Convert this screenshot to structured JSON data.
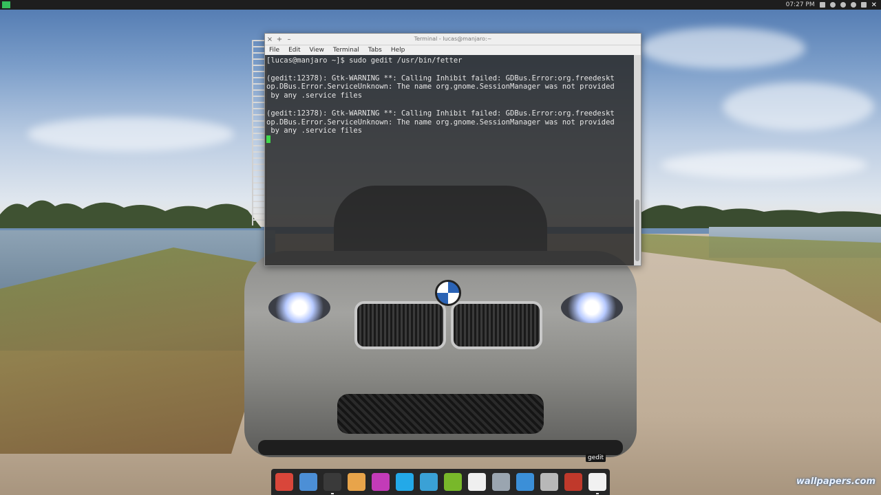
{
  "top_panel": {
    "clock": "07:27 PM"
  },
  "terminal": {
    "title": "Terminal - lucas@manjaro:~",
    "controls": {
      "close": "×",
      "maximize": "+",
      "minimize": "–"
    },
    "menu": [
      "File",
      "Edit",
      "View",
      "Terminal",
      "Tabs",
      "Help"
    ],
    "lines": [
      "[lucas@manjaro ~]$ sudo gedit /usr/bin/fetter",
      "",
      "(gedit:12378): Gtk-WARNING **: Calling Inhibit failed: GDBus.Error:org.freedeskt",
      "op.DBus.Error.ServiceUnknown: The name org.gnome.SessionManager was not provided",
      " by any .service files",
      "",
      "(gedit:12378): Gtk-WARNING **: Calling Inhibit failed: GDBus.Error:org.freedeskt",
      "op.DBus.Error.ServiceUnknown: The name org.gnome.SessionManager was not provided",
      " by any .service files"
    ]
  },
  "dock": {
    "tooltip": "gedit",
    "items": [
      {
        "icon": "toolbox-icon",
        "color": "#d9463a",
        "running": false
      },
      {
        "icon": "web-browser-icon",
        "color": "#4c8fd6",
        "running": false
      },
      {
        "icon": "terminal-icon",
        "color": "#3a3a3a",
        "running": true
      },
      {
        "icon": "video-editor-icon",
        "color": "#e8a44a",
        "running": false
      },
      {
        "icon": "crossover-icon",
        "color": "#c33bb8",
        "running": false
      },
      {
        "icon": "skype-icon",
        "color": "#23a9e8",
        "running": false
      },
      {
        "icon": "system-monitor-icon",
        "color": "#3aa1d6",
        "running": false
      },
      {
        "icon": "nvidia-icon",
        "color": "#78b82a",
        "running": false
      },
      {
        "icon": "text-file-icon",
        "color": "#efefef",
        "running": false
      },
      {
        "icon": "disk-icon",
        "color": "#9aa5b0",
        "running": false
      },
      {
        "icon": "network-icon",
        "color": "#3b8fd8",
        "running": false
      },
      {
        "icon": "mixer-icon",
        "color": "#b8b8b8",
        "running": false
      },
      {
        "icon": "color-balls-icon",
        "color": "#c0392b",
        "running": false
      },
      {
        "icon": "gedit-icon",
        "color": "#f1f1f1",
        "running": true
      }
    ]
  },
  "watermark": "wallpapers.com"
}
